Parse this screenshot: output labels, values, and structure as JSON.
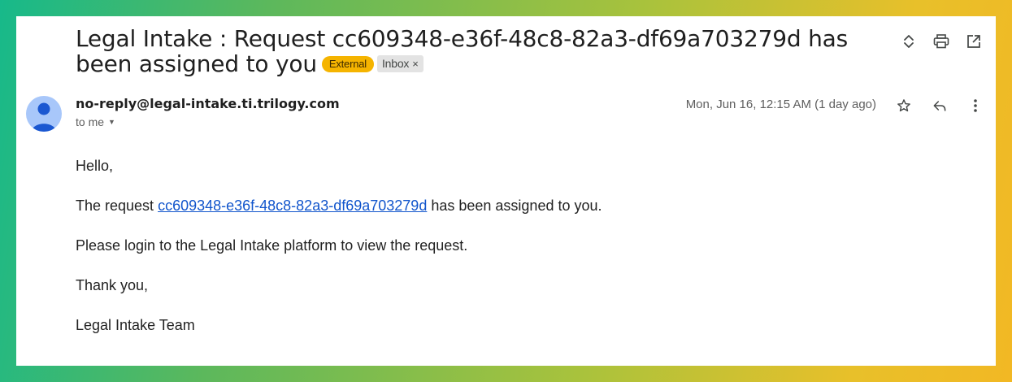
{
  "email": {
    "subject": "Legal Intake : Request cc609348-e36f-48c8-82a3-df69a703279d has been assigned to you",
    "labels": {
      "external": "External",
      "inbox": "Inbox",
      "inbox_remove": "×"
    },
    "sender": "no-reply@legal-intake.ti.trilogy.com",
    "recipient": "to me",
    "date": "Mon, Jun 16, 12:15 AM (1 day ago)",
    "body": {
      "greeting": "Hello,",
      "line1_prefix": "The request ",
      "line1_link": "cc609348-e36f-48c8-82a3-df69a703279d",
      "line1_suffix": " has been assigned to you.",
      "line2": "Please login to the Legal Intake platform to view the request.",
      "closing": "Thank you,",
      "signature": "Legal Intake Team"
    }
  },
  "icons": {
    "top": [
      "expand-collapse-icon",
      "print-icon",
      "open-in-new-window-icon"
    ],
    "message": [
      "star-icon",
      "reply-icon",
      "more-vert-icon"
    ]
  },
  "colors": {
    "external_badge": "#f5b400",
    "inbox_badge": "#e3e3e3",
    "link": "#1155cc",
    "avatar": "#a8c7fa"
  }
}
